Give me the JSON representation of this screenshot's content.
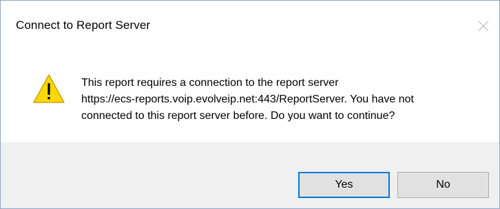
{
  "dialog": {
    "title": "Connect to Report Server",
    "close_icon": "close-icon",
    "icon": "warning-icon",
    "colors": {
      "warning_fill": "#ffd800",
      "warning_stroke": "#c8a400",
      "footer_bg": "#f0f0f0",
      "default_button_border": "#0078d7"
    },
    "message_lines": [
      "This report requires a connection to the report server",
      "https://ecs-reports.voip.evolveip.net:443/ReportServer. You have not",
      "connected to this report server before. Do you want to continue?"
    ],
    "buttons": {
      "yes_label": "Yes",
      "no_label": "No"
    }
  }
}
